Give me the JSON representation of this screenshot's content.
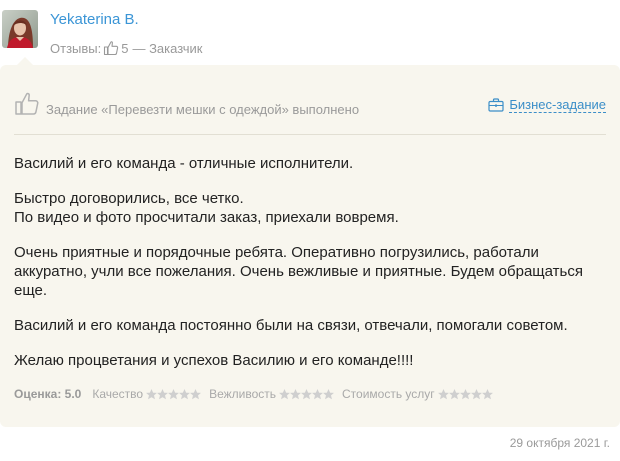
{
  "author": {
    "name": "Yekaterina B.",
    "reviews_label": "Отзывы:",
    "reviews_count": "5",
    "role": "— Заказчик"
  },
  "task": {
    "title": "Задание «Перевезти мешки с одеждой» выполнено",
    "biz_label": "Бизнес-задание"
  },
  "review": {
    "paragraphs": [
      [
        "Василий и его команда - отличные исполнители."
      ],
      [
        "Быстро договорились, все четко.",
        "По видео и фото просчитали заказ, приехали вовремя."
      ],
      [
        "Очень приятные и порядочные ребята. Оперативно погрузились, работали",
        "аккуратно, учли все пожелания. Очень вежливые и приятные. Будем обращаться",
        "еще."
      ],
      [
        "Василий и его команда постоянно были на связи, отвечали, помогали советом."
      ],
      [
        "Желаю процветания и успехов Василию и его команде!!!!"
      ]
    ]
  },
  "ratings": {
    "score_label": "Оценка: 5.0",
    "categories": [
      {
        "label": "Качество",
        "stars": 5
      },
      {
        "label": "Вежливость",
        "stars": 5
      },
      {
        "label": "Стоимость услуг",
        "stars": 5
      }
    ]
  },
  "date": "29 октября 2021 г.",
  "colors": {
    "link": "#3b95d6",
    "muted": "#9a9a9a",
    "card_bg": "#f8f6ee",
    "star": "#cfcfcf"
  }
}
